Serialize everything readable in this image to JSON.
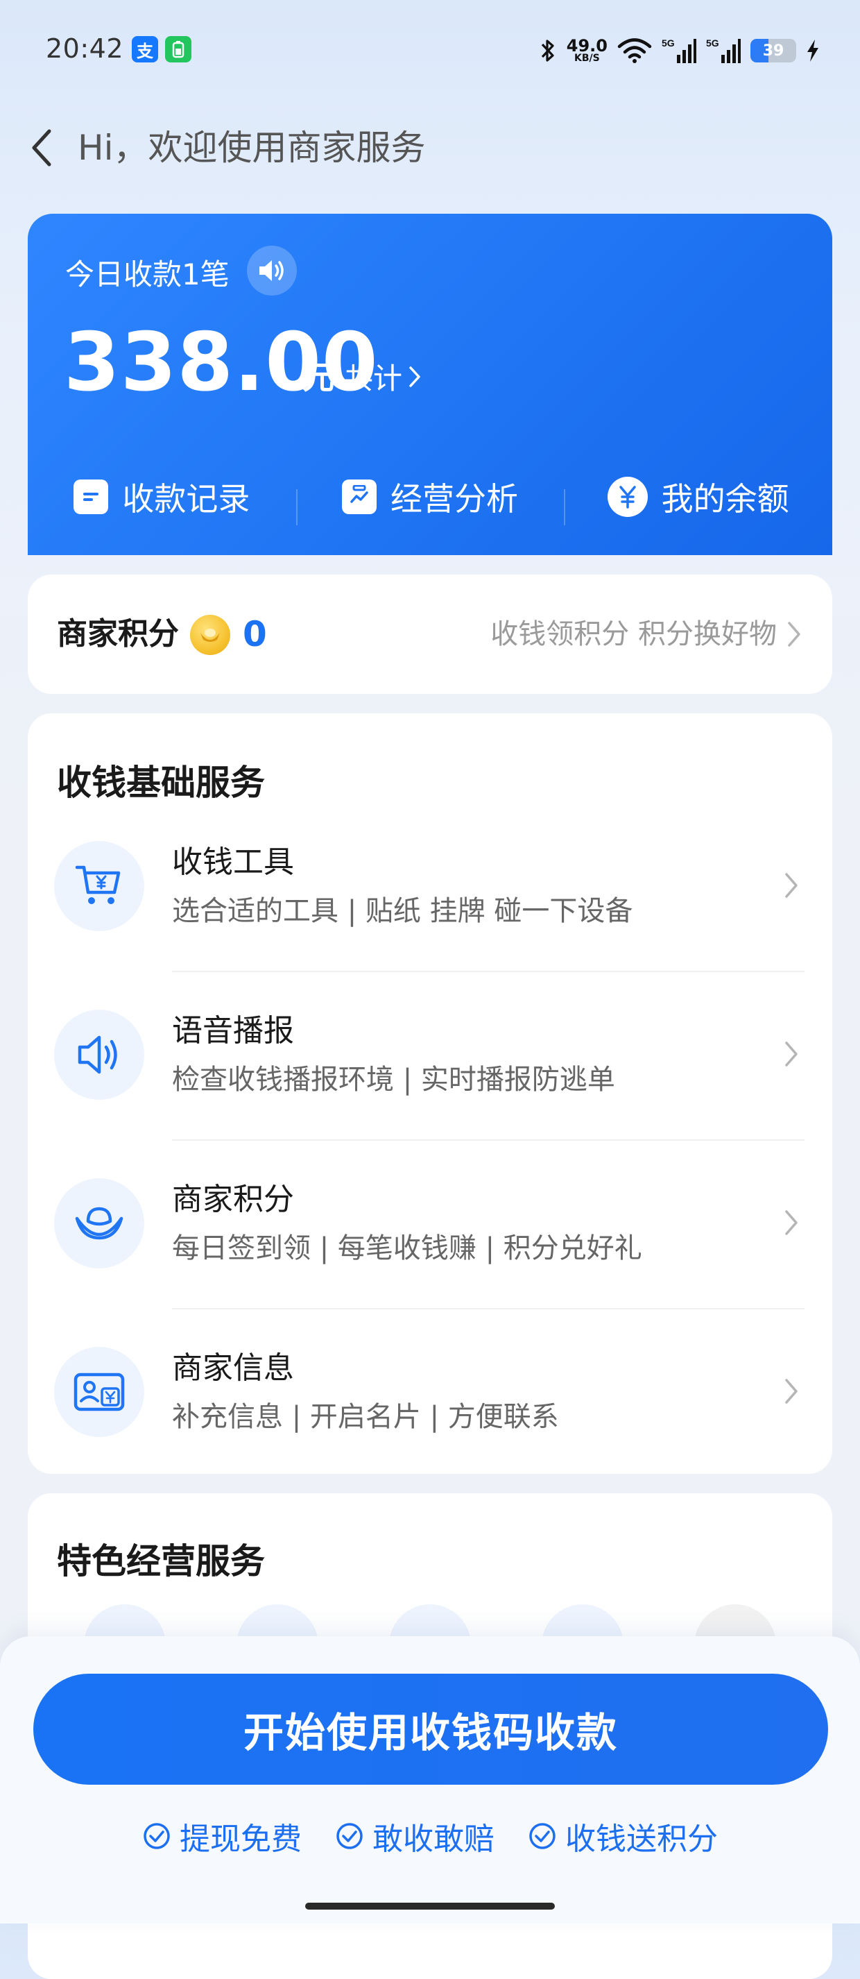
{
  "status_bar": {
    "time": "20:42",
    "app_badges": [
      {
        "icon": "alipay-icon",
        "label": "支",
        "color": "#1677ff"
      },
      {
        "icon": "battery-saver-icon",
        "label": "▯",
        "color": "#22c55e"
      }
    ],
    "net_speed_value": "49.0",
    "net_speed_unit": "KB/S",
    "battery_level": "39",
    "battery_fraction": 0.39
  },
  "header": {
    "title": "Hi，欢迎使用商家服务"
  },
  "summary": {
    "today_label": "今日收款1笔",
    "amount": "338.00",
    "unit": "元",
    "total_link": "共计",
    "actions": [
      {
        "label": "收款记录",
        "icon": "receipt-icon"
      },
      {
        "label": "经营分析",
        "icon": "analytics-icon"
      },
      {
        "label": "我的余额",
        "icon": "yuan-icon"
      }
    ]
  },
  "points": {
    "title": "商家积分",
    "value": "0",
    "promo": "收钱领积分 积分换好物"
  },
  "basic_services": {
    "title": "收钱基础服务",
    "items": [
      {
        "title": "收钱工具",
        "desc": "选合适的工具 | 贴纸 挂牌 碰一下设备",
        "icon": "cart-yuan-icon"
      },
      {
        "title": "语音播报",
        "desc": "检查收钱播报环境 | 实时播报防逃单",
        "icon": "speaker-icon"
      },
      {
        "title": "商家积分",
        "desc": "每日签到领 | 每笔收钱赚 | 积分兑好礼",
        "icon": "ingot-icon"
      },
      {
        "title": "商家信息",
        "desc": "补充信息 | 开启名片 | 方便联系",
        "icon": "id-card-icon"
      }
    ]
  },
  "feature_services": {
    "title": "特色经营服务"
  },
  "bottom": {
    "cta_label": "开始使用收钱码收款",
    "benefits": [
      "提现免费",
      "敢收敢赔",
      "收钱送积分"
    ]
  },
  "colors": {
    "brand_blue": "#1f75f3",
    "points_blue": "#1b72f2",
    "coin_gold": "#f6c231"
  }
}
